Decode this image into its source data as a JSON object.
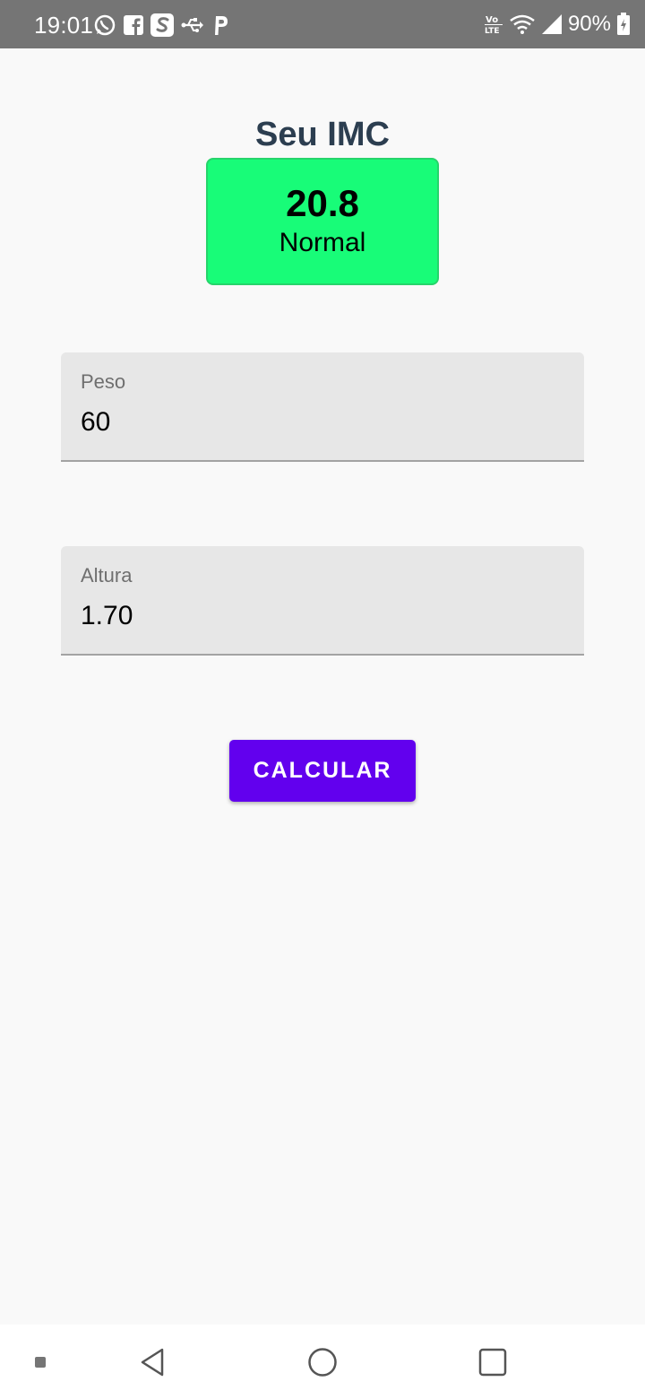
{
  "status_bar": {
    "time": "19:01",
    "left_icons": [
      "whatsapp-icon",
      "facebook-icon",
      "s-app-icon",
      "usb-icon",
      "p-app-icon"
    ],
    "right_icons": [
      "volte-icon",
      "wifi-icon",
      "signal-icon",
      "battery-icon"
    ],
    "battery": "90%"
  },
  "result": {
    "title": "Seu IMC",
    "value": "20.8",
    "classification": "Normal",
    "card_color": "#18fc78"
  },
  "form": {
    "weight": {
      "label": "Peso",
      "value": "60"
    },
    "height": {
      "label": "Altura",
      "value": "1.70"
    },
    "calculate_label": "CALCULAR"
  },
  "colors": {
    "accent": "#6200ee",
    "title": "#2c3e50",
    "status_bar": "#757575"
  },
  "nav_bar": {
    "icons": [
      "recent-dot-icon",
      "back-icon",
      "home-icon",
      "overview-icon"
    ]
  }
}
